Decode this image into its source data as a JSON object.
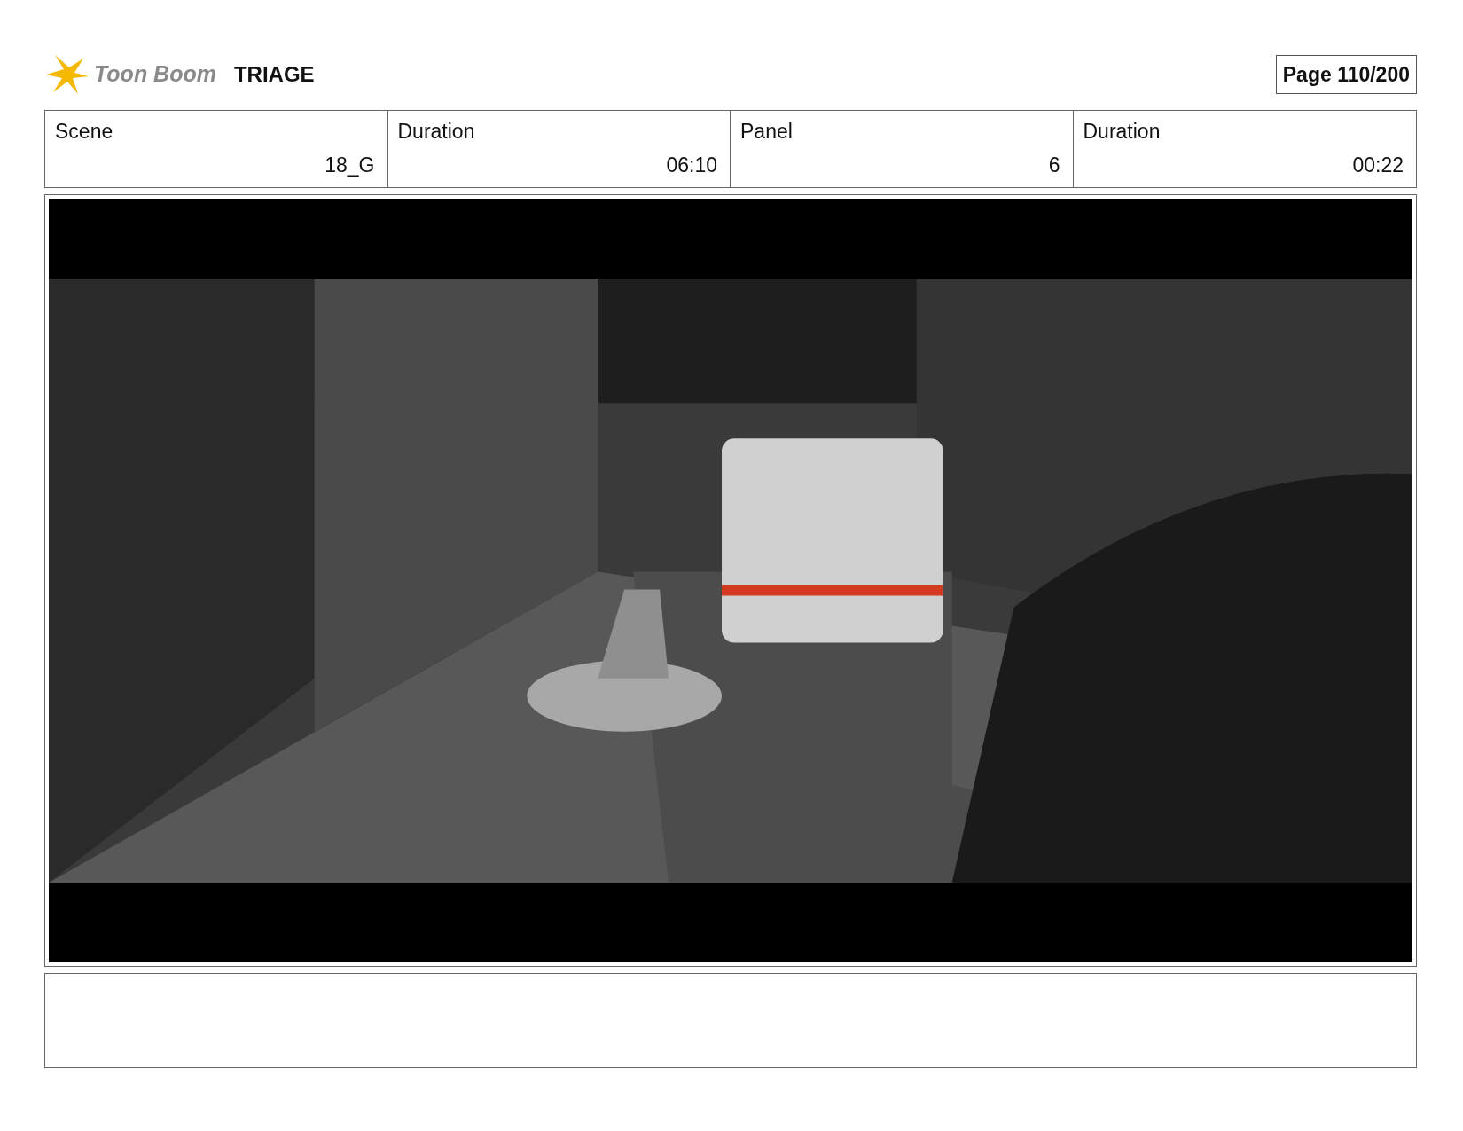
{
  "header": {
    "logo_text": "Toon Boom",
    "project": "TRIAGE",
    "page": "Page 110/200"
  },
  "fields": [
    {
      "label": "Scene",
      "value": "18_G"
    },
    {
      "label": "Duration",
      "value": "06:10"
    },
    {
      "label": "Panel",
      "value": "6"
    },
    {
      "label": "Duration",
      "value": "00:22"
    }
  ]
}
